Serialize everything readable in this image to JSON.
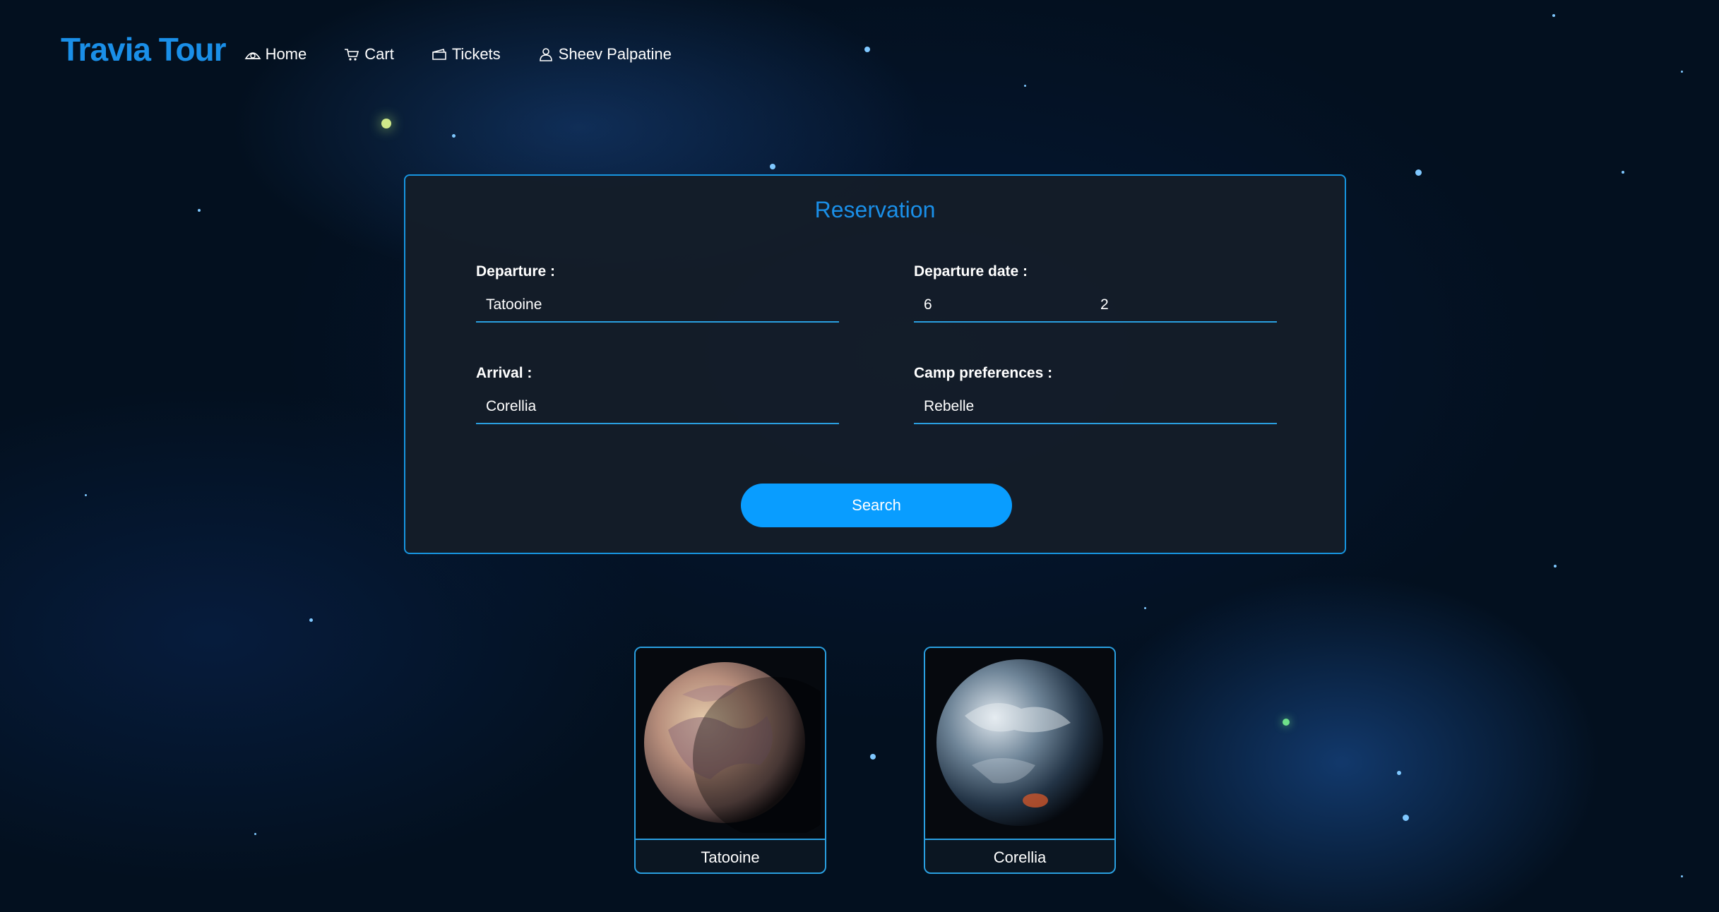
{
  "nav": {
    "logo": "Travia Tour",
    "items": [
      {
        "label": "Home",
        "icon": "home-icon"
      },
      {
        "label": "Cart",
        "icon": "cart-icon"
      },
      {
        "label": "Tickets",
        "icon": "ticket-icon"
      },
      {
        "label": "Sheev Palpatine",
        "icon": "user-icon"
      }
    ]
  },
  "reservation": {
    "title": "Reservation",
    "departure": {
      "label": "Departure :",
      "value": "Tatooine"
    },
    "departure_date": {
      "label": "Departure date :",
      "day": "6",
      "month": "2"
    },
    "arrival": {
      "label": "Arrival :",
      "value": "Corellia"
    },
    "camp": {
      "label": "Camp preferences :",
      "value": "Rebelle"
    },
    "search_label": "Search"
  },
  "destinations": [
    {
      "name": "Tatooine"
    },
    {
      "name": "Corellia"
    }
  ],
  "colors": {
    "accent": "#1a8fe8",
    "button": "#099dff",
    "panel": "#141d29"
  }
}
